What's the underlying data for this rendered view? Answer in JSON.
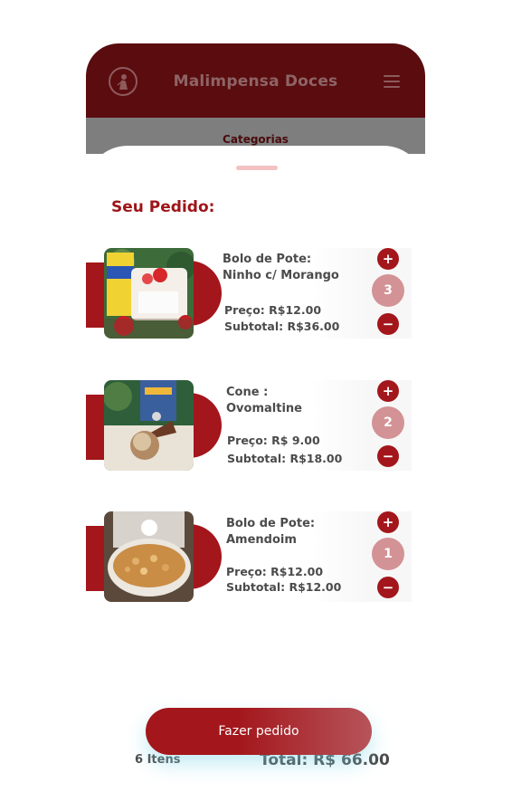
{
  "header": {
    "title": "Malimpensa Doces",
    "logo_icon": "woman-silhouette-logo-icon",
    "menu_icon": "hamburger-menu-icon"
  },
  "categories": {
    "label": "Categorias"
  },
  "cart": {
    "title": "Seu Pedido:",
    "items": [
      {
        "name_line1": "Bolo de Pote:",
        "name_line2": "Ninho c/ Morango",
        "price": "Preço: R$12.00",
        "subtotal": "Subtotal: R$36.00",
        "quantity": "3"
      },
      {
        "name_line1": "Cone :",
        "name_line2": "Ovomaltine",
        "price": "Preço: R$ 9.00",
        "subtotal": "Subtotal: R$18.00",
        "quantity": "2"
      },
      {
        "name_line1": "Bolo de Pote:",
        "name_line2": "Amendoim",
        "price": "Preço: R$12.00",
        "subtotal": "Subtotal: R$12.00",
        "quantity": "1"
      }
    ],
    "plus_label": "+",
    "minus_label": "−",
    "items_count": "6 Itens",
    "total": "Total: R$ 66.00",
    "order_button": "Fazer pedido"
  },
  "colors": {
    "header_bg": "#5a0c0f",
    "accent": "#a3161b",
    "quantity_bubble": "#d39295",
    "text": "#4b4b4b"
  }
}
